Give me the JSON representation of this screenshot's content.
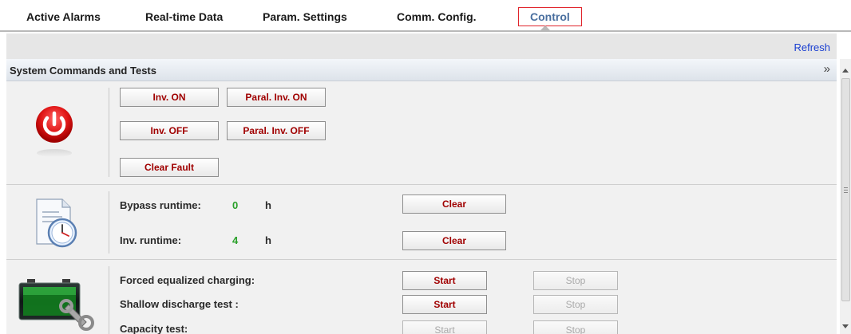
{
  "nav": {
    "tabs": [
      {
        "label": "Active Alarms"
      },
      {
        "label": "Real-time Data"
      },
      {
        "label": "Param. Settings"
      },
      {
        "label": "Comm. Config."
      },
      {
        "label": "Control",
        "active": true
      }
    ]
  },
  "toolbar": {
    "refresh_label": "Refresh"
  },
  "panel": {
    "title": "System Commands and Tests",
    "collapse_icon": "double-chevron-right-icon"
  },
  "power_section": {
    "icon": "power-icon",
    "buttons": {
      "inv_on": "Inv. ON",
      "paral_inv_on": "Paral. Inv. ON",
      "inv_off": "Inv. OFF",
      "paral_inv_off": "Paral. Inv. OFF",
      "clear_fault": "Clear Fault"
    }
  },
  "runtime_section": {
    "icon": "document-clock-icon",
    "rows": [
      {
        "label": "Bypass runtime:",
        "value": "0",
        "unit": "h",
        "button": "Clear"
      },
      {
        "label": "Inv. runtime:",
        "value": "4",
        "unit": "h",
        "button": "Clear"
      }
    ]
  },
  "battery_section": {
    "icon": "battery-wrench-icon",
    "rows": [
      {
        "label": "Forced equalized charging:",
        "start": "Start",
        "stop": "Stop",
        "start_enabled": true,
        "stop_enabled": false
      },
      {
        "label": "Shallow discharge test :",
        "start": "Start",
        "stop": "Stop",
        "start_enabled": true,
        "stop_enabled": false
      },
      {
        "label": "Capacity test:",
        "start": "Start",
        "stop": "Stop",
        "start_enabled": false,
        "stop_enabled": false
      }
    ]
  },
  "colors": {
    "accent_red": "#a00000",
    "value_green": "#2aa02a",
    "link_blue": "#1a3fd1",
    "active_tab_border": "#e0242b"
  }
}
